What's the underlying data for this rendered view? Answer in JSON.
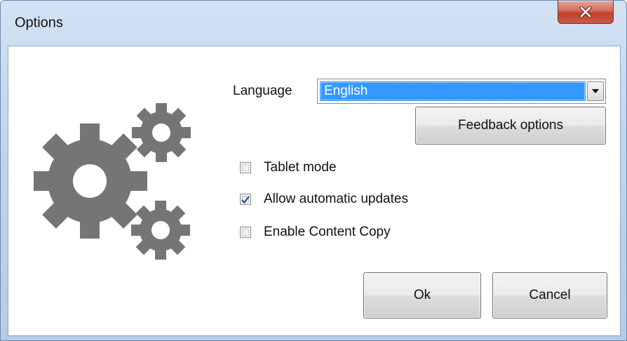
{
  "window": {
    "title": "Options",
    "close_icon": "close-icon",
    "colors": {
      "titlebar": "#bfd4ec",
      "close_button": "#c95a44",
      "selection": "#3399ff",
      "gear": "#757575"
    }
  },
  "illustration": {
    "icon": "gears-icon"
  },
  "language": {
    "label": "Language",
    "selected": "English",
    "arrow_icon": "chevron-down-icon"
  },
  "buttons": {
    "feedback": "Feedback options",
    "ok": "Ok",
    "cancel": "Cancel"
  },
  "checkboxes": [
    {
      "label": "Tablet mode",
      "checked": false
    },
    {
      "label": "Allow automatic updates",
      "checked": true
    },
    {
      "label": "Enable Content Copy",
      "checked": false
    }
  ]
}
